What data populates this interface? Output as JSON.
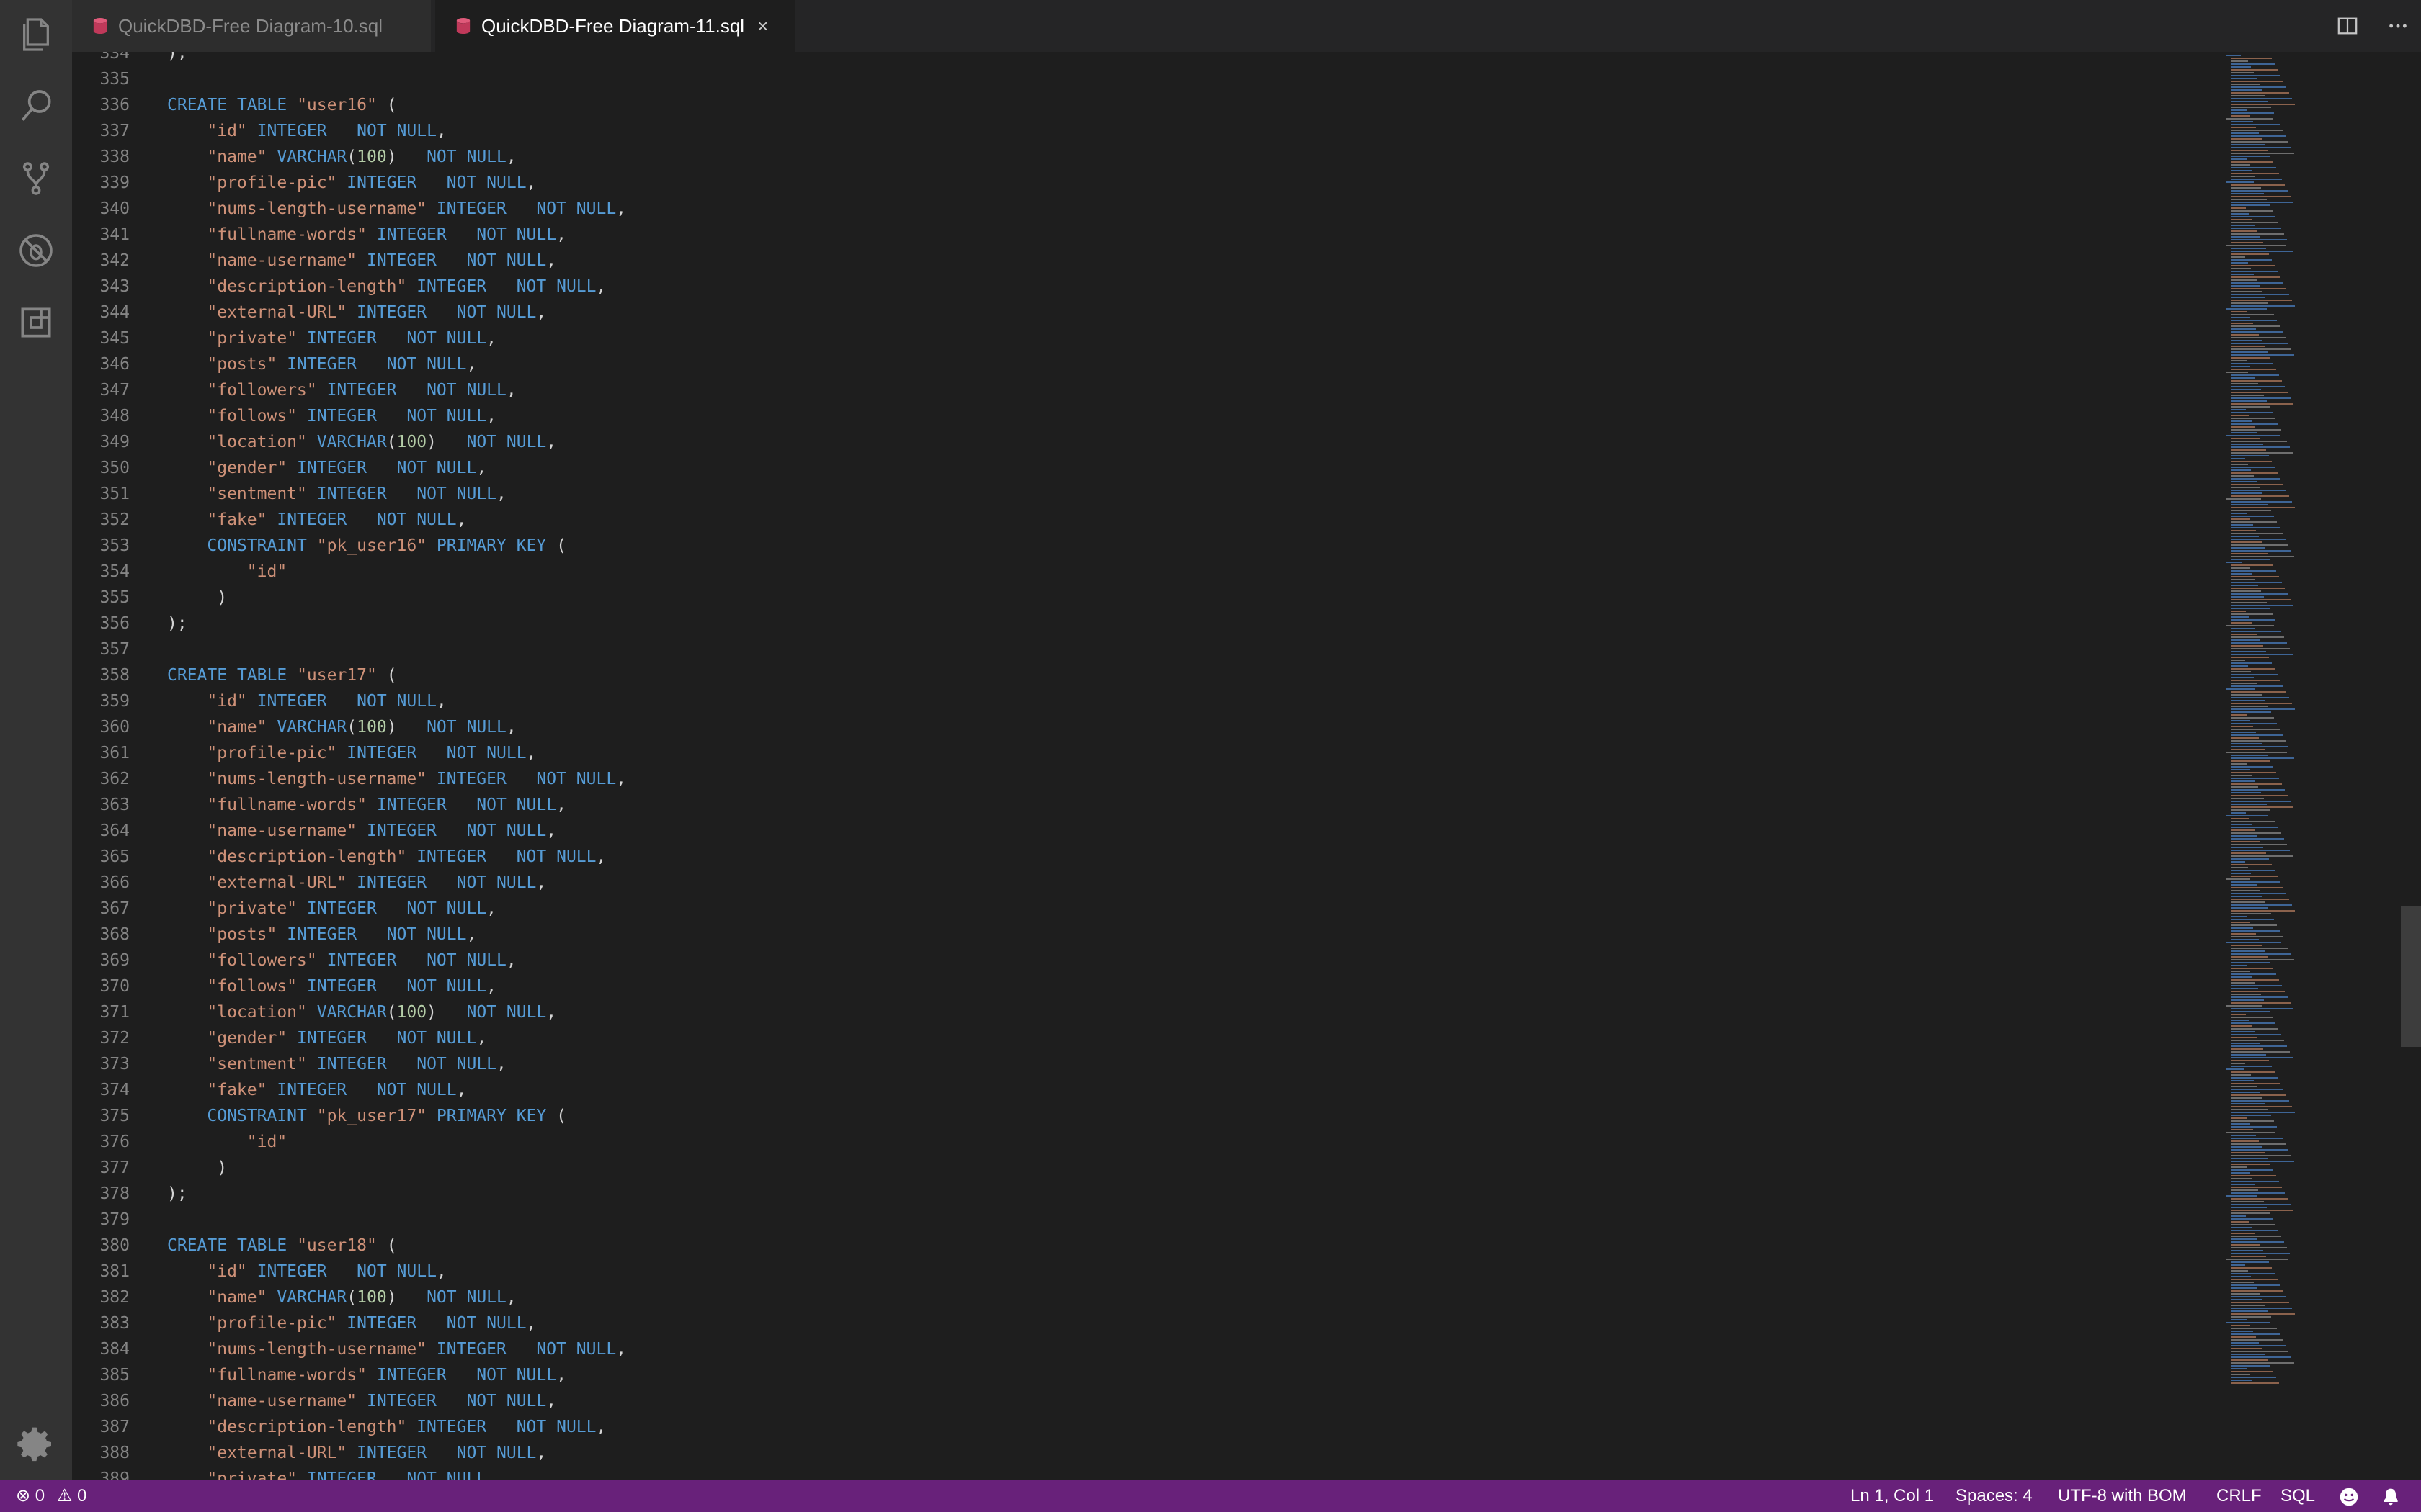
{
  "tabs": [
    {
      "label": "QuickDBD-Free Diagram-10.sql",
      "active": false
    },
    {
      "label": "QuickDBD-Free Diagram-11.sql",
      "active": true
    }
  ],
  "tab_close_glyph": "×",
  "activity_bar": [
    "files-icon",
    "search-icon",
    "source-control-icon",
    "debug-icon",
    "extensions-icon",
    "gear-icon"
  ],
  "editor": {
    "first_line_number": 334,
    "lines": [
      ");",
      "",
      "CREATE TABLE \"user16\" (",
      "    \"id\" INTEGER   NOT NULL,",
      "    \"name\" VARCHAR(100)   NOT NULL,",
      "    \"profile-pic\" INTEGER   NOT NULL,",
      "    \"nums-length-username\" INTEGER   NOT NULL,",
      "    \"fullname-words\" INTEGER   NOT NULL,",
      "    \"name-username\" INTEGER   NOT NULL,",
      "    \"description-length\" INTEGER   NOT NULL,",
      "    \"external-URL\" INTEGER   NOT NULL,",
      "    \"private\" INTEGER   NOT NULL,",
      "    \"posts\" INTEGER   NOT NULL,",
      "    \"followers\" INTEGER   NOT NULL,",
      "    \"follows\" INTEGER   NOT NULL,",
      "    \"location\" VARCHAR(100)   NOT NULL,",
      "    \"gender\" INTEGER   NOT NULL,",
      "    \"sentment\" INTEGER   NOT NULL,",
      "    \"fake\" INTEGER   NOT NULL,",
      "    CONSTRAINT \"pk_user16\" PRIMARY KEY (",
      "        \"id\"",
      "     )",
      ");",
      "",
      "CREATE TABLE \"user17\" (",
      "    \"id\" INTEGER   NOT NULL,",
      "    \"name\" VARCHAR(100)   NOT NULL,",
      "    \"profile-pic\" INTEGER   NOT NULL,",
      "    \"nums-length-username\" INTEGER   NOT NULL,",
      "    \"fullname-words\" INTEGER   NOT NULL,",
      "    \"name-username\" INTEGER   NOT NULL,",
      "    \"description-length\" INTEGER   NOT NULL,",
      "    \"external-URL\" INTEGER   NOT NULL,",
      "    \"private\" INTEGER   NOT NULL,",
      "    \"posts\" INTEGER   NOT NULL,",
      "    \"followers\" INTEGER   NOT NULL,",
      "    \"follows\" INTEGER   NOT NULL,",
      "    \"location\" VARCHAR(100)   NOT NULL,",
      "    \"gender\" INTEGER   NOT NULL,",
      "    \"sentment\" INTEGER   NOT NULL,",
      "    \"fake\" INTEGER   NOT NULL,",
      "    CONSTRAINT \"pk_user17\" PRIMARY KEY (",
      "        \"id\"",
      "     )",
      ");",
      "",
      "CREATE TABLE \"user18\" (",
      "    \"id\" INTEGER   NOT NULL,",
      "    \"name\" VARCHAR(100)   NOT NULL,",
      "    \"profile-pic\" INTEGER   NOT NULL,",
      "    \"nums-length-username\" INTEGER   NOT NULL,",
      "    \"fullname-words\" INTEGER   NOT NULL,",
      "    \"name-username\" INTEGER   NOT NULL,",
      "    \"description-length\" INTEGER   NOT NULL,",
      "    \"external-URL\" INTEGER   NOT NULL,",
      "    \"private\" INTEGER   NOT NULL,"
    ]
  },
  "status_bar": {
    "errors": "0",
    "warnings": "0",
    "cursor": "Ln 1, Col 1",
    "indent": "Spaces: 4",
    "encoding": "UTF-8 with BOM",
    "eol": "CRLF",
    "language": "SQL"
  },
  "colors": {
    "keyword": "#569cd6",
    "string": "#ce9178",
    "number": "#b5cea8",
    "status_bar": "#68217a"
  }
}
